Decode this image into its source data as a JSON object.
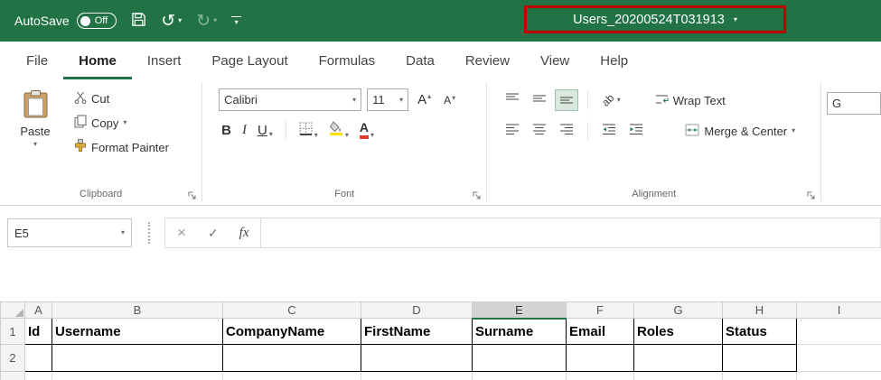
{
  "title_bar": {
    "autosave_label": "AutoSave",
    "autosave_state": "Off",
    "filename": "Users_20200524T031913"
  },
  "tabs": [
    {
      "label": "File"
    },
    {
      "label": "Home"
    },
    {
      "label": "Insert"
    },
    {
      "label": "Page Layout"
    },
    {
      "label": "Formulas"
    },
    {
      "label": "Data"
    },
    {
      "label": "Review"
    },
    {
      "label": "View"
    },
    {
      "label": "Help"
    }
  ],
  "ribbon": {
    "clipboard": {
      "label": "Clipboard",
      "paste": "Paste",
      "cut": "Cut",
      "copy": "Copy",
      "format_painter": "Format Painter"
    },
    "font": {
      "label": "Font",
      "name": "Calibri",
      "size": "11",
      "bold": "B",
      "italic": "I",
      "underline": "U"
    },
    "alignment": {
      "label": "Alignment",
      "wrap_text": "Wrap Text",
      "merge_center": "Merge & Center"
    },
    "number_partial": "G"
  },
  "formula_bar": {
    "name_box": "E5",
    "fx": "fx",
    "value": ""
  },
  "icons": {
    "caret": "▾",
    "caret_up": "▴",
    "undo": "↺",
    "redo": "↻",
    "cancel": "×",
    "check": "✓",
    "letter_a": "A",
    "orientation": "ab"
  },
  "colors": {
    "excel_green": "#217346",
    "annotation_red": "#C00000",
    "fill_yellow": "#FFE000",
    "font_color_red": "#E03C31"
  },
  "grid": {
    "columns": [
      "A",
      "B",
      "C",
      "D",
      "E",
      "F",
      "G",
      "H",
      "I"
    ],
    "selected_column": "E",
    "rows": [
      {
        "num": "1",
        "cells": [
          "Id",
          "Username",
          "CompanyName",
          "FirstName",
          "Surname",
          "Email",
          "Roles",
          "Status",
          ""
        ]
      },
      {
        "num": "2",
        "cells": [
          "",
          "",
          "",
          "",
          "",
          "",
          "",
          "",
          ""
        ]
      }
    ]
  }
}
